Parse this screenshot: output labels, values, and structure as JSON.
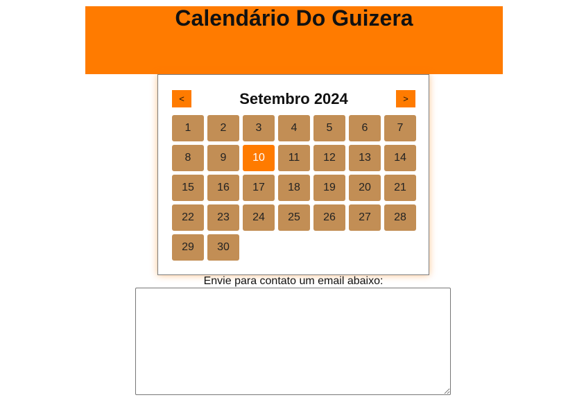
{
  "header": {
    "title": "Calendário Do Guizera"
  },
  "calendar": {
    "month_title": "Setembro 2024",
    "prev_label": "<",
    "next_label": ">",
    "today": 10,
    "days": [
      "1",
      "2",
      "3",
      "4",
      "5",
      "6",
      "7",
      "8",
      "9",
      "10",
      "11",
      "12",
      "13",
      "14",
      "15",
      "16",
      "17",
      "18",
      "19",
      "20",
      "21",
      "22",
      "23",
      "24",
      "25",
      "26",
      "27",
      "28",
      "29",
      "30"
    ]
  },
  "contact": {
    "label": "Envie para contato um email abaixo:",
    "value": "",
    "placeholder": ""
  },
  "colors": {
    "accent": "#ff7b00",
    "day_cell": "#c28e55"
  }
}
